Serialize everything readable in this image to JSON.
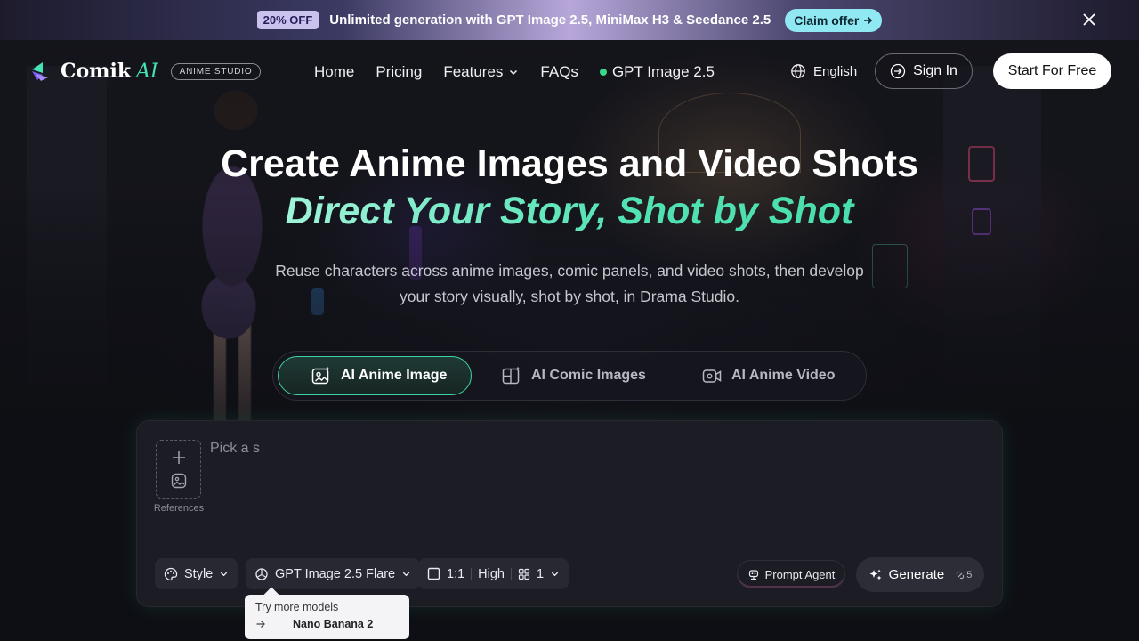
{
  "promo": {
    "badge": "20% OFF",
    "text": "Unlimited generation with GPT Image 2.5, MiniMax H3 & Seedance 2.5",
    "claim_label": "Claim offer",
    "claim_icon": "arrow-right-icon",
    "close_icon": "close-icon"
  },
  "header": {
    "logo_name": "Comik",
    "logo_ai": "AI",
    "studio_badge": "ANIME STUDIO",
    "nav": {
      "home": "Home",
      "pricing": "Pricing",
      "features": "Features",
      "faqs": "FAQs",
      "model": "GPT Image 2.5"
    },
    "language": "English",
    "signin": "Sign In",
    "start": "Start For Free"
  },
  "hero": {
    "title": "Create Anime Images and Video Shots",
    "subtitle": "Direct Your Story, Shot by Shot",
    "description": "Reuse characters across anime images, comic panels, and video shots, then develop your story visually, shot by shot, in Drama Studio."
  },
  "tabs": {
    "image": "AI Anime Image",
    "comic": "AI Comic Images",
    "video": "AI Anime Video",
    "active": "AI Anime Image"
  },
  "panel": {
    "references_label": "References",
    "prompt_value": "Pick a s",
    "style_label": "Style",
    "model_label": "GPT Image 2.5 Flare",
    "ratio": "1:1",
    "quality": "High",
    "count": "1",
    "prompt_agent": "Prompt Agent",
    "generate": "Generate",
    "generate_cost": "5"
  },
  "tooltip": {
    "title": "Try more models",
    "model": "Nano Banana 2"
  },
  "colors": {
    "accent": "#47e3b4",
    "claim": "#8fe8f2",
    "status_dot": "#3ad88a"
  }
}
